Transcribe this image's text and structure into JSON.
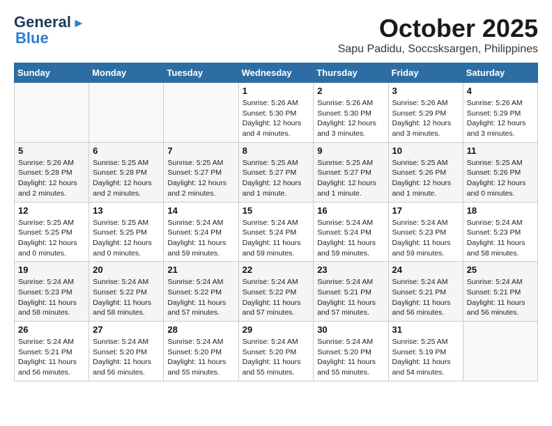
{
  "logo": {
    "line1": "General",
    "line2": "Blue"
  },
  "title": {
    "month": "October 2025",
    "location": "Sapu Padidu, Soccsksargen, Philippines"
  },
  "weekdays": [
    "Sunday",
    "Monday",
    "Tuesday",
    "Wednesday",
    "Thursday",
    "Friday",
    "Saturday"
  ],
  "weeks": [
    [
      {
        "day": "",
        "info": ""
      },
      {
        "day": "",
        "info": ""
      },
      {
        "day": "",
        "info": ""
      },
      {
        "day": "1",
        "info": "Sunrise: 5:26 AM\nSunset: 5:30 PM\nDaylight: 12 hours and 4 minutes."
      },
      {
        "day": "2",
        "info": "Sunrise: 5:26 AM\nSunset: 5:30 PM\nDaylight: 12 hours and 3 minutes."
      },
      {
        "day": "3",
        "info": "Sunrise: 5:26 AM\nSunset: 5:29 PM\nDaylight: 12 hours and 3 minutes."
      },
      {
        "day": "4",
        "info": "Sunrise: 5:26 AM\nSunset: 5:29 PM\nDaylight: 12 hours and 3 minutes."
      }
    ],
    [
      {
        "day": "5",
        "info": "Sunrise: 5:26 AM\nSunset: 5:28 PM\nDaylight: 12 hours and 2 minutes."
      },
      {
        "day": "6",
        "info": "Sunrise: 5:25 AM\nSunset: 5:28 PM\nDaylight: 12 hours and 2 minutes."
      },
      {
        "day": "7",
        "info": "Sunrise: 5:25 AM\nSunset: 5:27 PM\nDaylight: 12 hours and 2 minutes."
      },
      {
        "day": "8",
        "info": "Sunrise: 5:25 AM\nSunset: 5:27 PM\nDaylight: 12 hours and 1 minute."
      },
      {
        "day": "9",
        "info": "Sunrise: 5:25 AM\nSunset: 5:27 PM\nDaylight: 12 hours and 1 minute."
      },
      {
        "day": "10",
        "info": "Sunrise: 5:25 AM\nSunset: 5:26 PM\nDaylight: 12 hours and 1 minute."
      },
      {
        "day": "11",
        "info": "Sunrise: 5:25 AM\nSunset: 5:26 PM\nDaylight: 12 hours and 0 minutes."
      }
    ],
    [
      {
        "day": "12",
        "info": "Sunrise: 5:25 AM\nSunset: 5:25 PM\nDaylight: 12 hours and 0 minutes."
      },
      {
        "day": "13",
        "info": "Sunrise: 5:25 AM\nSunset: 5:25 PM\nDaylight: 12 hours and 0 minutes."
      },
      {
        "day": "14",
        "info": "Sunrise: 5:24 AM\nSunset: 5:24 PM\nDaylight: 11 hours and 59 minutes."
      },
      {
        "day": "15",
        "info": "Sunrise: 5:24 AM\nSunset: 5:24 PM\nDaylight: 11 hours and 59 minutes."
      },
      {
        "day": "16",
        "info": "Sunrise: 5:24 AM\nSunset: 5:24 PM\nDaylight: 11 hours and 59 minutes."
      },
      {
        "day": "17",
        "info": "Sunrise: 5:24 AM\nSunset: 5:23 PM\nDaylight: 11 hours and 59 minutes."
      },
      {
        "day": "18",
        "info": "Sunrise: 5:24 AM\nSunset: 5:23 PM\nDaylight: 11 hours and 58 minutes."
      }
    ],
    [
      {
        "day": "19",
        "info": "Sunrise: 5:24 AM\nSunset: 5:23 PM\nDaylight: 11 hours and 58 minutes."
      },
      {
        "day": "20",
        "info": "Sunrise: 5:24 AM\nSunset: 5:22 PM\nDaylight: 11 hours and 58 minutes."
      },
      {
        "day": "21",
        "info": "Sunrise: 5:24 AM\nSunset: 5:22 PM\nDaylight: 11 hours and 57 minutes."
      },
      {
        "day": "22",
        "info": "Sunrise: 5:24 AM\nSunset: 5:22 PM\nDaylight: 11 hours and 57 minutes."
      },
      {
        "day": "23",
        "info": "Sunrise: 5:24 AM\nSunset: 5:21 PM\nDaylight: 11 hours and 57 minutes."
      },
      {
        "day": "24",
        "info": "Sunrise: 5:24 AM\nSunset: 5:21 PM\nDaylight: 11 hours and 56 minutes."
      },
      {
        "day": "25",
        "info": "Sunrise: 5:24 AM\nSunset: 5:21 PM\nDaylight: 11 hours and 56 minutes."
      }
    ],
    [
      {
        "day": "26",
        "info": "Sunrise: 5:24 AM\nSunset: 5:21 PM\nDaylight: 11 hours and 56 minutes."
      },
      {
        "day": "27",
        "info": "Sunrise: 5:24 AM\nSunset: 5:20 PM\nDaylight: 11 hours and 56 minutes."
      },
      {
        "day": "28",
        "info": "Sunrise: 5:24 AM\nSunset: 5:20 PM\nDaylight: 11 hours and 55 minutes."
      },
      {
        "day": "29",
        "info": "Sunrise: 5:24 AM\nSunset: 5:20 PM\nDaylight: 11 hours and 55 minutes."
      },
      {
        "day": "30",
        "info": "Sunrise: 5:24 AM\nSunset: 5:20 PM\nDaylight: 11 hours and 55 minutes."
      },
      {
        "day": "31",
        "info": "Sunrise: 5:25 AM\nSunset: 5:19 PM\nDaylight: 11 hours and 54 minutes."
      },
      {
        "day": "",
        "info": ""
      }
    ]
  ]
}
